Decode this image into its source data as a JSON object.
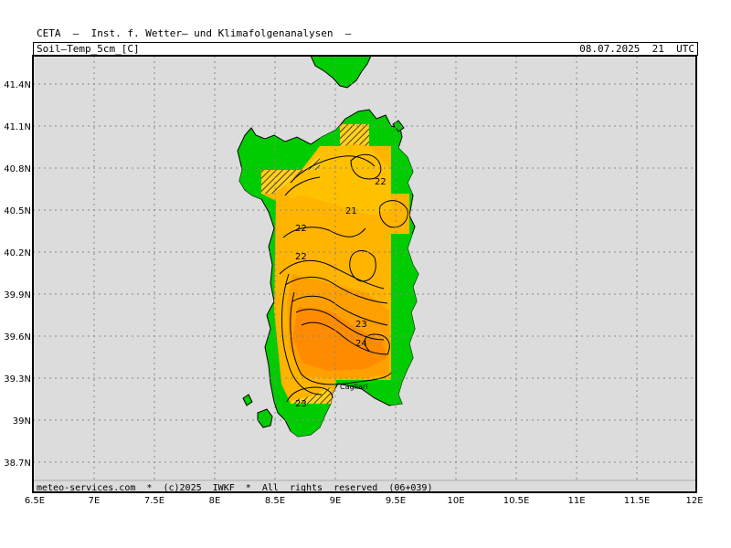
{
  "header": {
    "title": "CETA  —  Inst. f. Wetter— und Klimafolgenanalysen  —",
    "field": "Soil—Temp_5cm_[C]",
    "valid_time": "08.07.2025  21  UTC"
  },
  "footer": {
    "credit": "meteo-services.com  *  (c)2025  IWKF  *  All  rights  reserved  (06+039)"
  },
  "axes": {
    "lon_ticks": [
      "6.5E",
      "7E",
      "7.5E",
      "8E",
      "8.5E",
      "9E",
      "9.5E",
      "10E",
      "10.5E",
      "11E",
      "11.5E",
      "12E"
    ],
    "lat_ticks": [
      "41.4N",
      "41.1N",
      "40.8N",
      "40.5N",
      "40.2N",
      "39.9N",
      "39.6N",
      "39.3N",
      "39N",
      "38.7N"
    ]
  },
  "contour_labels": [
    "22",
    "21",
    "22",
    "22",
    "23",
    "24",
    "23"
  ],
  "place_label": "Cagliari",
  "colors": {
    "sea": "#dcdcdc",
    "land": "#00cc00",
    "temp_21": "#ffc000",
    "temp_22": "#ffb400",
    "temp_23": "#ffa000",
    "temp_24": "#ff8c00",
    "temp_cool": "#ffd020"
  }
}
